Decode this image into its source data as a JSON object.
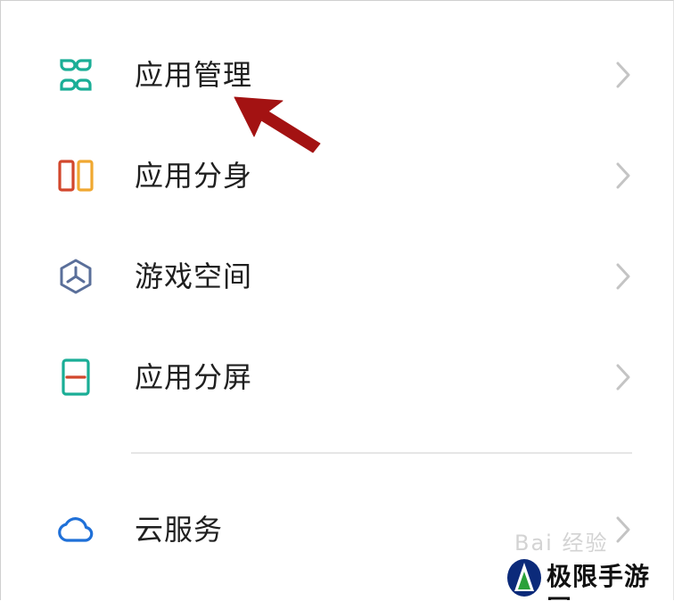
{
  "settings_list": {
    "items": [
      {
        "label": "应用管理",
        "icon": "app-management-icon",
        "icon_color": "#1aae96"
      },
      {
        "label": "应用分身",
        "icon": "app-clone-icon",
        "icon_color": "#e0822e"
      },
      {
        "label": "游戏空间",
        "icon": "game-space-icon",
        "icon_color": "#5a6f9a"
      },
      {
        "label": "应用分屏",
        "icon": "split-screen-icon",
        "icon_color": "#1aae96"
      },
      {
        "label": "云服务",
        "icon": "cloud-icon",
        "icon_color": "#1f70d8"
      }
    ]
  },
  "annotation": {
    "arrow_color": "#a31212"
  },
  "watermark": {
    "text": "Bai 经验"
  },
  "brand": {
    "text": "极限手游网",
    "logo_colors": [
      "#0b2a7a",
      "#2aa13a"
    ]
  }
}
